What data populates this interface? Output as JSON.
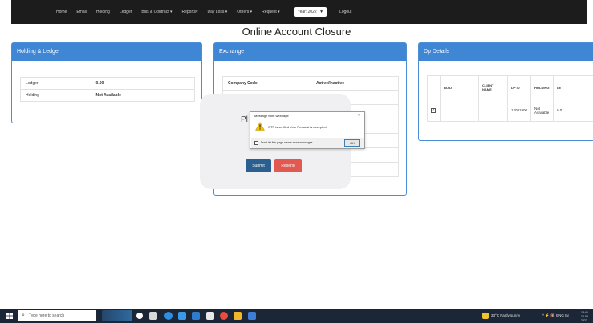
{
  "navbar": {
    "items": [
      "Home",
      "Email",
      "Holding",
      "Ledger",
      "Bills & Contract ▾",
      "Reports▾",
      "Day Loss ▾",
      "Others ▾",
      "Request ▾"
    ],
    "year_label": "Year: 2022",
    "logout": "Logout"
  },
  "page": {
    "title": "Online Account Closure"
  },
  "holding_panel": {
    "title": "Holding & Ledger",
    "rows": [
      {
        "label": "Ledger",
        "value": "0.00"
      },
      {
        "label": "Holding",
        "value": "Not Available"
      }
    ]
  },
  "exchange_panel": {
    "title": "Exchange",
    "headers": [
      "Company Code",
      "Active/Inactive"
    ]
  },
  "dp_panel": {
    "title": "Dp Details",
    "headers": [
      "BOID",
      "CLIENT NAME",
      "DP ID",
      "HOLDING",
      "LE"
    ],
    "row": {
      "checked": "✓",
      "boid": "",
      "client_name": "",
      "dp_id": "12081900",
      "holding": "Not Available",
      "ledger": "0.0"
    }
  },
  "overlay": {
    "partial_text": "Pl",
    "submit_label": "Submit",
    "resend_label": "Resend"
  },
  "message_box": {
    "title": "Message from webpage",
    "close": "×",
    "text": "OTP is verified Your Request is accepted.",
    "checkbox_label": "Don't let this page create more messages",
    "ok_label": "OK",
    "icon": "warning-icon"
  },
  "taskbar": {
    "search_placeholder": "Type here to search",
    "weather": "33°C Partly sunny",
    "tray": "^ ⚡ 🔇 ENG IN",
    "time": "18:45",
    "date": "14-06-2022"
  },
  "colors": {
    "navbar": "#1c1c1c",
    "panel_header": "#3f86d4",
    "submit": "#2b5f8f",
    "resend": "#e05a51",
    "taskbar": "#1b2636"
  }
}
